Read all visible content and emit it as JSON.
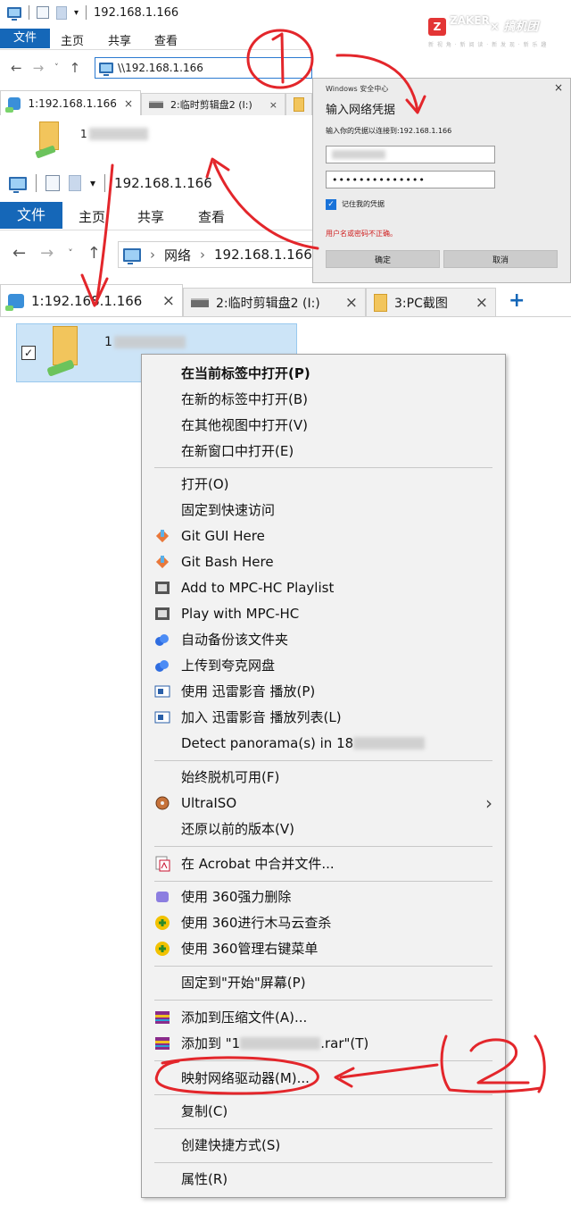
{
  "top_window": {
    "title": "192.168.1.166",
    "ribbon_tabs": [
      "文件",
      "主页",
      "共享",
      "查看"
    ],
    "address": "\\\\192.168.1.166",
    "tabs": [
      {
        "label": "1:192.168.1.166",
        "close": "×"
      },
      {
        "label": "2:临时剪辑盘2 (I:)",
        "close": "×"
      }
    ],
    "item_name": "1"
  },
  "watermark": {
    "brand": "ZAKER",
    "sub": "× 搞机团",
    "tagline": "新 视 角 · 新 阅 读 · 新 发 现 · 新 乐 趣"
  },
  "dialog": {
    "title": "Windows 安全中心",
    "close": "×",
    "heading": "输入网络凭据",
    "prompt": "输入你的凭据以连接到:192.168.1.166",
    "password_mask": "••••••••••••••",
    "remember_label": "记住我的凭据",
    "error": "用户名或密码不正确。",
    "ok_label": "确定",
    "cancel_label": "取消"
  },
  "main_window": {
    "title": "192.168.1.166",
    "ribbon_tabs": [
      "文件",
      "主页",
      "共享",
      "查看"
    ],
    "breadcrumb": [
      "网络",
      "192.168.1.166"
    ],
    "tabs": [
      {
        "label": "1:192.168.1.166",
        "close": "×"
      },
      {
        "label": "2:临时剪辑盘2 (I:)",
        "close": "×"
      },
      {
        "label": "3:PC截图",
        "close": "×"
      }
    ],
    "add_tab": "+",
    "item_name": "1"
  },
  "context_menu": {
    "items": [
      {
        "label": "在当前标签中打开(P)",
        "bold": true
      },
      {
        "label": "在新的标签中打开(B)"
      },
      {
        "label": "在其他视图中打开(V)"
      },
      {
        "label": "在新窗口中打开(E)"
      },
      {
        "label": "打开(O)"
      },
      {
        "label": "固定到快速访问"
      },
      {
        "label": "Git GUI Here",
        "icon": "git-icon"
      },
      {
        "label": "Git Bash Here",
        "icon": "git-icon"
      },
      {
        "label": "Add to MPC-HC Playlist",
        "icon": "film-icon"
      },
      {
        "label": "Play with MPC-HC",
        "icon": "film-icon"
      },
      {
        "label": "自动备份该文件夹",
        "icon": "cloud-icon"
      },
      {
        "label": "上传到夸克网盘",
        "icon": "cloud-icon"
      },
      {
        "label": "使用 迅雷影音 播放(P)",
        "icon": "player-icon"
      },
      {
        "label": "加入 迅雷影音 播放列表(L)",
        "icon": "player-icon"
      },
      {
        "label": "Detect panorama(s) in 18"
      },
      {
        "label": "始终脱机可用(F)"
      },
      {
        "label": "UltraISO",
        "icon": "disc-icon",
        "submenu": "›"
      },
      {
        "label": "还原以前的版本(V)"
      },
      {
        "label": "在 Acrobat 中合并文件...",
        "icon": "acrobat-icon"
      },
      {
        "label": "使用 360强力删除",
        "icon": "shredder-icon"
      },
      {
        "label": "使用 360进行木马云查杀",
        "icon": "360-icon"
      },
      {
        "label": "使用 360管理右键菜单",
        "icon": "360-icon"
      },
      {
        "label": "固定到\"开始\"屏幕(P)"
      },
      {
        "label": "添加到压缩文件(A)...",
        "icon": "rar-icon"
      },
      {
        "label": "添加到 \"1",
        "suffix": ".rar\"(T)",
        "icon": "rar-icon"
      },
      {
        "label": "映射网络驱动器(M)..."
      },
      {
        "label": "复制(C)"
      },
      {
        "label": "创建快捷方式(S)"
      },
      {
        "label": "属性(R)"
      }
    ]
  },
  "annotations": {
    "circle_1": "①",
    "circle_2": "2"
  },
  "colors": {
    "ribbon_active": "#1567b8",
    "annotation_red": "#e3262b",
    "selection": "#cce4f7"
  }
}
